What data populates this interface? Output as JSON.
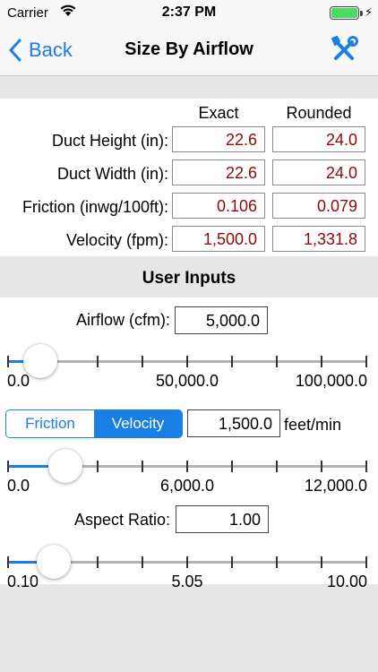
{
  "status_bar": {
    "carrier": "Carrier",
    "time": "2:37 PM"
  },
  "nav": {
    "back_label": "Back",
    "title": "Size By Airflow",
    "tools_icon": "tools-icon"
  },
  "results": {
    "col_exact": "Exact",
    "col_rounded": "Rounded",
    "rows": [
      {
        "label": "Duct Height (in):",
        "exact": "22.6",
        "rounded": "24.0"
      },
      {
        "label": "Duct Width (in):",
        "exact": "22.6",
        "rounded": "24.0"
      },
      {
        "label": "Friction (inwg/100ft):",
        "exact": "0.106",
        "rounded": "0.079"
      },
      {
        "label": "Velocity (fpm):",
        "exact": "1,500.0",
        "rounded": "1,331.8"
      }
    ]
  },
  "user_inputs": {
    "header": "User Inputs",
    "airflow": {
      "label": "Airflow (cfm):",
      "value": "5,000.0",
      "slider": {
        "min_label": "0.0",
        "mid_label": "50,000.0",
        "max_label": "100,000.0",
        "position": 0.05
      }
    },
    "mode": {
      "options": [
        "Friction",
        "Velocity"
      ],
      "selected": "Velocity",
      "value": "1,500.0",
      "unit": "feet/min",
      "slider": {
        "min_label": "0.0",
        "mid_label": "6,000.0",
        "max_label": "12,000.0",
        "position": 0.125
      }
    },
    "aspect": {
      "label": "Aspect Ratio:",
      "value": "1.00",
      "slider": {
        "min_label": "0.10",
        "mid_label": "5.05",
        "max_label": "10.00",
        "position": 0.09
      }
    }
  },
  "colors": {
    "accent": "#1a7fe4",
    "result_text": "#8b0a0a",
    "battery": "#4cd964",
    "background": "#e6e6e6"
  }
}
